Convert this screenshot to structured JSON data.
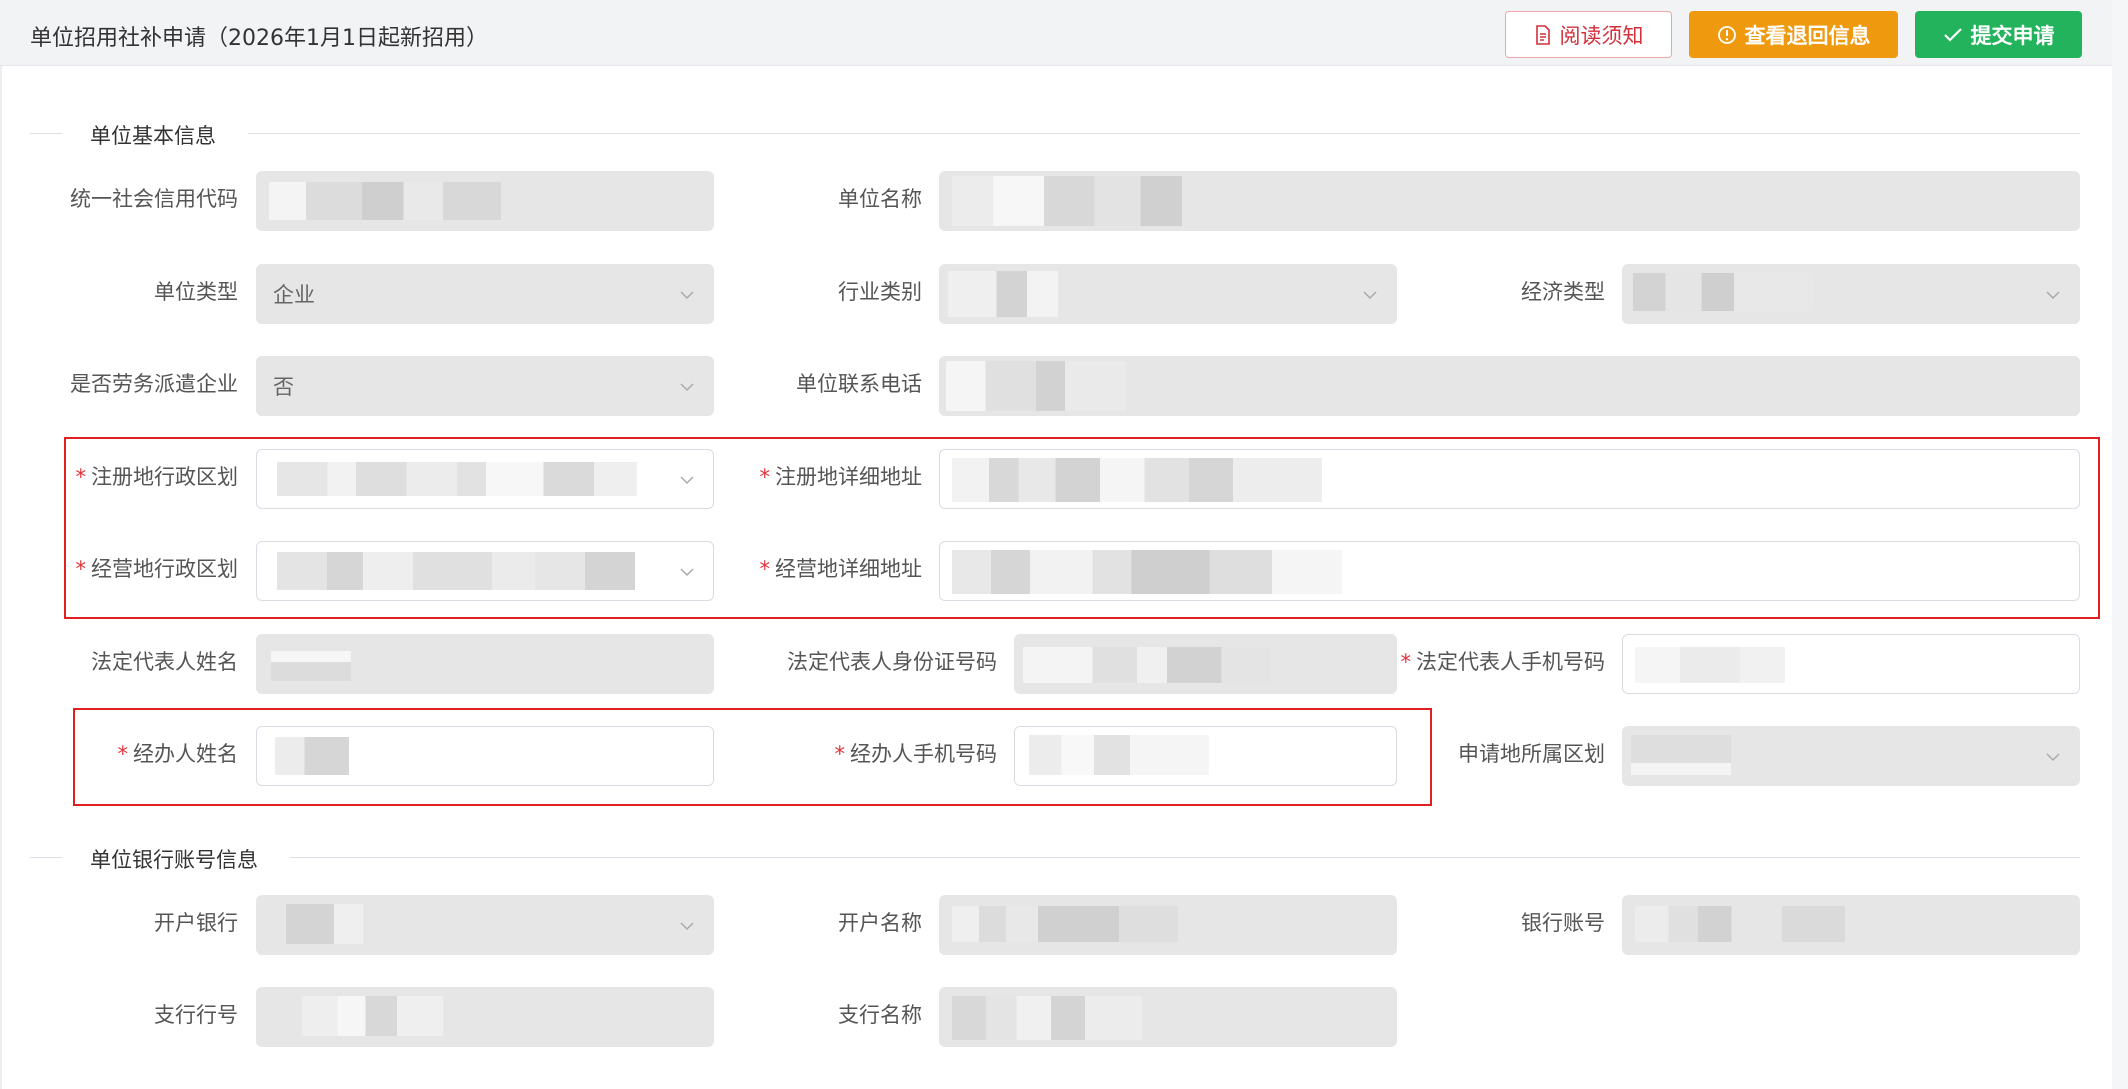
{
  "header": {
    "title": "单位招用社补申请（2026年1月1日起新招用）",
    "buttons": {
      "read_notice": "阅读须知",
      "view_return": "查看退回信息",
      "submit": "提交申请"
    },
    "icons": {
      "read_notice": "document-icon",
      "view_return": "alert-circle-icon",
      "submit": "check-icon"
    }
  },
  "sections": {
    "basic": "单位基本信息",
    "bank": "单位银行账号信息"
  },
  "labels": {
    "credit_code": "统一社会信用代码",
    "unit_name": "单位名称",
    "unit_type": "单位类型",
    "industry": "行业类别",
    "economy_type": "经济类型",
    "dispatch": "是否劳务派遣企业",
    "unit_phone": "单位联系电话",
    "reg_region": "注册地行政区划",
    "reg_address": "注册地详细地址",
    "biz_region": "经营地行政区划",
    "biz_address": "经营地详细地址",
    "legal_name": "法定代表人姓名",
    "legal_id": "法定代表人身份证号码",
    "legal_phone": "法定代表人手机号码",
    "agent_name": "经办人姓名",
    "agent_phone": "经办人手机号码",
    "apply_region": "申请地所属区划",
    "bank": "开户银行",
    "account_name": "开户名称",
    "account_no": "银行账号",
    "branch_no": "支行行号",
    "branch_name": "支行名称"
  },
  "required_mark": "*",
  "values": {
    "unit_type": "企业",
    "dispatch": "否"
  },
  "colors": {
    "accent_red": "#d3303b",
    "warning_orange": "#ef9a0e",
    "success_green": "#22b35c",
    "highlight_red": "#e02020"
  }
}
